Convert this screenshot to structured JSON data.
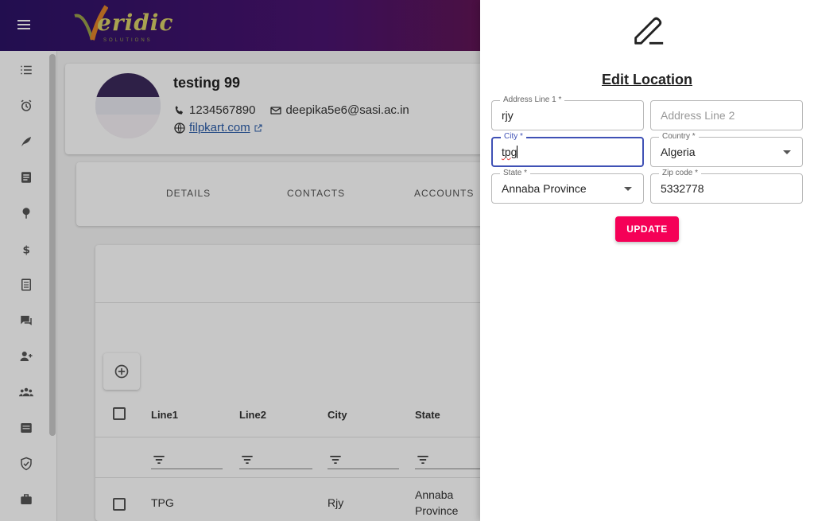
{
  "header": {
    "logo_text": "eridic",
    "logo_sub": "SOLUTIONS"
  },
  "sidebar": {
    "items": [
      {
        "icon": "checklist-icon"
      },
      {
        "icon": "alarm-icon"
      },
      {
        "icon": "leaf-icon"
      },
      {
        "icon": "document-icon"
      },
      {
        "icon": "tree-icon"
      },
      {
        "icon": "dollar-icon"
      },
      {
        "icon": "notes-icon"
      },
      {
        "icon": "chat-icon"
      },
      {
        "icon": "add-user-icon"
      },
      {
        "icon": "group-icon"
      },
      {
        "icon": "inbox-icon"
      },
      {
        "icon": "shield-check-icon"
      },
      {
        "icon": "briefcase-icon"
      }
    ]
  },
  "profile": {
    "name": "testing 99",
    "phone": "1234567890",
    "email": "deepika5e6@sasi.ac.in",
    "website": "filpkart.com"
  },
  "tabs": [
    {
      "label": "DETAILS"
    },
    {
      "label": "CONTACTS"
    },
    {
      "label": "ACCOUNTS"
    }
  ],
  "table": {
    "columns": [
      "Line1",
      "Line2",
      "City",
      "State"
    ],
    "rows": [
      {
        "line1": "TPG",
        "line2": "",
        "city": "Rjy",
        "state_line1": "Annaba",
        "state_line2": "Province"
      }
    ]
  },
  "drawer": {
    "title": "Edit Location",
    "fields": {
      "address1": {
        "label": "Address Line 1 *",
        "value": "rjy"
      },
      "address2": {
        "placeholder": "Address Line 2"
      },
      "city": {
        "label": "City *",
        "value": "tpg"
      },
      "country": {
        "label": "Country *",
        "value": "Algeria"
      },
      "state": {
        "label": "State *",
        "value": "Annaba Province"
      },
      "zip": {
        "label": "Zip code *",
        "value": "5332778"
      }
    },
    "update_label": "UPDATE"
  },
  "colors": {
    "accent": "#f50057",
    "focus": "#3f51b5",
    "link": "#2a5ca8"
  }
}
